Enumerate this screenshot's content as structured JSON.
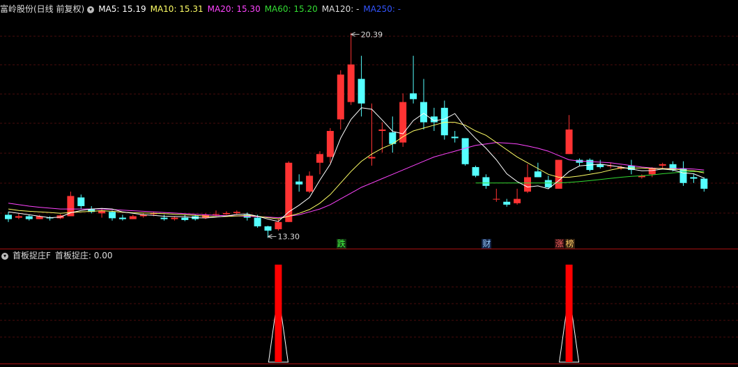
{
  "main_panel": {
    "stock": "富岭股份(日线 前复权)",
    "ma_labels": [
      {
        "text": "MA5: 15.19",
        "color": "#ffffff"
      },
      {
        "text": "MA10: 15.31",
        "color": "#ffff66"
      },
      {
        "text": "MA20: 15.30",
        "color": "#ff44ff"
      },
      {
        "text": "MA60: 15.20",
        "color": "#33dd33"
      },
      {
        "text": "MA120: -",
        "color": "#dddddd"
      },
      {
        "text": "MA250: -",
        "color": "#3355ff"
      }
    ],
    "high_label": "20.39",
    "low_label": "13.30",
    "markers": [
      {
        "text": "跌",
        "color": "#44ff44",
        "bg": "#113311",
        "candle": 32
      },
      {
        "text": "财",
        "color": "#99ccff",
        "bg": "#112244",
        "candle": 46
      },
      {
        "text": "涨",
        "color": "#ff6666",
        "bg": "#331111",
        "candle": 53
      },
      {
        "text": "榜",
        "color": "#ffcc66",
        "bg": "#332211",
        "candle": 54
      }
    ]
  },
  "sub_panel": {
    "title": "首板捉庄F",
    "value_label": "首板捉庄: 0.00"
  },
  "chart_data": {
    "type": "candlestick",
    "colors": {
      "up": "#ff3333",
      "down": "#55ffff",
      "ma5": "#ffffff",
      "ma10": "#ffff66",
      "ma20": "#ff44ff",
      "ma60": "#33dd33"
    },
    "ohlc": [
      [
        14.1,
        14.2,
        13.85,
        13.95
      ],
      [
        14.0,
        14.15,
        13.95,
        14.05
      ],
      [
        14.05,
        14.1,
        13.9,
        13.95
      ],
      [
        13.95,
        14.1,
        13.95,
        14.05
      ],
      [
        14.0,
        14.05,
        13.9,
        13.98
      ],
      [
        13.98,
        14.12,
        13.95,
        14.08
      ],
      [
        14.05,
        14.9,
        14.05,
        14.75
      ],
      [
        14.7,
        14.8,
        14.3,
        14.4
      ],
      [
        14.3,
        14.4,
        14.15,
        14.2
      ],
      [
        14.15,
        14.3,
        14.0,
        14.25
      ],
      [
        14.2,
        14.25,
        13.9,
        13.98
      ],
      [
        14.0,
        14.1,
        13.9,
        13.95
      ],
      [
        13.95,
        14.1,
        13.95,
        14.05
      ],
      [
        14.05,
        14.15,
        14.0,
        14.1
      ],
      [
        14.12,
        14.2,
        14.05,
        14.15
      ],
      [
        14.0,
        14.1,
        13.9,
        13.95
      ],
      [
        13.95,
        14.05,
        13.9,
        14.0
      ],
      [
        14.0,
        14.1,
        13.88,
        13.92
      ],
      [
        14.05,
        14.1,
        13.9,
        13.95
      ],
      [
        14.0,
        14.15,
        13.95,
        14.1
      ],
      [
        14.1,
        14.25,
        14.05,
        14.12
      ],
      [
        14.12,
        14.22,
        14.1,
        14.16
      ],
      [
        14.16,
        14.25,
        14.12,
        14.2
      ],
      [
        14.1,
        14.18,
        13.9,
        14.0
      ],
      [
        14.0,
        14.1,
        13.65,
        13.7
      ],
      [
        13.7,
        13.72,
        13.3,
        13.55
      ],
      [
        13.6,
        13.95,
        13.55,
        13.85
      ],
      [
        13.85,
        15.95,
        13.85,
        15.9
      ],
      [
        15.25,
        15.5,
        14.9,
        15.15
      ],
      [
        14.9,
        15.6,
        14.85,
        15.45
      ],
      [
        15.9,
        16.3,
        15.5,
        16.2
      ],
      [
        16.1,
        17.1,
        15.9,
        17.0
      ],
      [
        17.4,
        19.1,
        17.05,
        18.95
      ],
      [
        18.0,
        20.39,
        17.9,
        19.3
      ],
      [
        18.8,
        19.6,
        17.5,
        17.95
      ],
      [
        16.05,
        17.95,
        15.8,
        16.1
      ],
      [
        17.0,
        17.3,
        16.25,
        17.05
      ],
      [
        16.95,
        17.5,
        16.25,
        16.55
      ],
      [
        16.6,
        18.3,
        16.45,
        18.0
      ],
      [
        18.3,
        19.6,
        17.95,
        18.1
      ],
      [
        18.0,
        18.8,
        17.05,
        17.3
      ],
      [
        17.5,
        17.8,
        17.0,
        17.3
      ],
      [
        17.8,
        18.05,
        16.7,
        16.85
      ],
      [
        16.8,
        17.0,
        16.6,
        16.75
      ],
      [
        16.75,
        16.75,
        15.8,
        15.85
      ],
      [
        15.75,
        15.8,
        15.4,
        15.45
      ],
      [
        15.4,
        15.5,
        15.0,
        15.1
      ],
      [
        14.65,
        15.0,
        14.55,
        14.65
      ],
      [
        14.55,
        14.65,
        14.38,
        14.45
      ],
      [
        14.5,
        15.0,
        14.45,
        14.65
      ],
      [
        14.9,
        15.85,
        14.85,
        15.4
      ],
      [
        15.6,
        15.9,
        15.4,
        15.4
      ],
      [
        15.3,
        15.45,
        15.0,
        15.05
      ],
      [
        15.0,
        16.0,
        15.0,
        16.0
      ],
      [
        16.2,
        17.55,
        16.2,
        17.05
      ],
      [
        16.0,
        16.05,
        15.8,
        15.9
      ],
      [
        16.0,
        16.05,
        15.6,
        15.65
      ],
      [
        15.85,
        16.0,
        15.7,
        15.75
      ],
      [
        15.8,
        15.9,
        15.7,
        15.8
      ],
      [
        15.7,
        15.8,
        15.65,
        15.75
      ],
      [
        15.8,
        16.0,
        15.5,
        15.65
      ],
      [
        15.4,
        15.5,
        15.35,
        15.45
      ],
      [
        15.5,
        15.75,
        15.4,
        15.7
      ],
      [
        15.8,
        15.9,
        15.7,
        15.85
      ],
      [
        15.85,
        15.95,
        15.6,
        15.65
      ],
      [
        15.7,
        15.95,
        15.1,
        15.2
      ],
      [
        15.4,
        15.5,
        15.2,
        15.35
      ],
      [
        15.35,
        15.4,
        14.9,
        15.0
      ]
    ],
    "ma5": [
      14.2,
      14.15,
      14.1,
      14.05,
      14.0,
      14.02,
      14.17,
      14.25,
      14.3,
      14.32,
      14.3,
      14.2,
      14.15,
      14.1,
      14.08,
      14.05,
      14.04,
      14.03,
      14.0,
      13.99,
      14.02,
      14.06,
      14.11,
      14.13,
      14.05,
      13.95,
      13.87,
      14.2,
      14.43,
      14.7,
      15.3,
      15.85,
      16.75,
      17.4,
      17.8,
      17.75,
      17.38,
      16.99,
      16.9,
      17.36,
      17.61,
      17.35,
      17.41,
      17.6,
      17.12,
      16.74,
      16.4,
      16.0,
      15.52,
      15.25,
      15.06,
      15.1,
      15.0,
      15.28,
      15.6,
      15.79,
      15.82,
      15.85,
      15.8,
      15.75,
      15.68,
      15.62,
      15.63,
      15.68,
      15.65,
      15.55,
      15.52,
      15.37
    ],
    "ma10": [
      14.3,
      14.25,
      14.22,
      14.2,
      14.18,
      14.15,
      14.18,
      14.2,
      14.22,
      14.24,
      14.22,
      14.19,
      14.17,
      14.16,
      14.15,
      14.14,
      14.12,
      14.1,
      14.08,
      14.05,
      14.03,
      14.04,
      14.06,
      14.08,
      14.05,
      14.0,
      13.96,
      14.05,
      14.15,
      14.28,
      14.5,
      14.8,
      15.2,
      15.6,
      15.95,
      16.2,
      16.4,
      16.55,
      16.8,
      17.0,
      17.1,
      17.2,
      17.3,
      17.3,
      17.2,
      17.0,
      16.85,
      16.6,
      16.35,
      16.1,
      15.9,
      15.7,
      15.5,
      15.4,
      15.4,
      15.44,
      15.5,
      15.56,
      15.65,
      15.72,
      15.72,
      15.72,
      15.7,
      15.7,
      15.68,
      15.65,
      15.62,
      15.55
    ],
    "ma20": [
      14.5,
      14.45,
      14.4,
      14.36,
      14.33,
      14.3,
      14.3,
      14.3,
      14.3,
      14.3,
      14.28,
      14.26,
      14.24,
      14.22,
      14.2,
      14.18,
      14.16,
      14.14,
      14.12,
      14.1,
      14.08,
      14.07,
      14.06,
      14.05,
      14.03,
      14.02,
      14.0,
      14.05,
      14.1,
      14.2,
      14.3,
      14.45,
      14.65,
      14.85,
      15.05,
      15.2,
      15.35,
      15.5,
      15.65,
      15.8,
      15.95,
      16.1,
      16.2,
      16.3,
      16.4,
      16.5,
      16.55,
      16.6,
      16.58,
      16.55,
      16.48,
      16.4,
      16.3,
      16.15,
      16.0,
      15.96,
      15.94,
      15.92,
      15.9,
      15.85,
      15.8,
      15.75,
      15.72,
      15.7,
      15.7,
      15.7,
      15.68,
      15.65
    ],
    "ma60_start": 45,
    "ma60": [
      15.2,
      15.2,
      15.2,
      15.2,
      15.2,
      15.2,
      15.2,
      15.2,
      15.2,
      15.22,
      15.25,
      15.28,
      15.32,
      15.36,
      15.4,
      15.43,
      15.45,
      15.48,
      15.52,
      15.55,
      15.58,
      15.6,
      15.6
    ],
    "signals": [
      26,
      54
    ],
    "y_range": [
      13.05,
      21.0
    ],
    "sub_range": [
      0,
      1
    ]
  }
}
